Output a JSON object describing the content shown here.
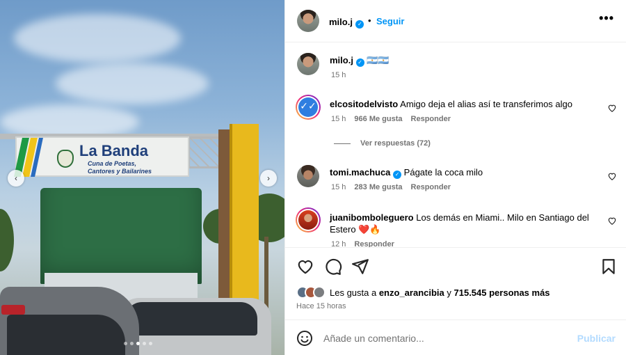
{
  "post": {
    "username": "milo.j",
    "follow_label": "Seguir",
    "separator": "•",
    "more_icon": "more-options-icon",
    "caption_emoji": "🇦🇷🇦🇷",
    "caption_time": "15 h"
  },
  "photo": {
    "sign_title": "La Banda",
    "sign_subtitle_1": "Cuna de Poetas,",
    "sign_subtitle_2": "Cantores y Bailarines",
    "prev_arrow": "‹",
    "next_arrow": "›",
    "slide_count": 5,
    "active_slide": 2
  },
  "comments": [
    {
      "username": "elcositodelvisto",
      "text": "Amigo deja el alias así te transferimos algo",
      "time": "15 h",
      "likes": "966 Me gusta",
      "reply": "Responder"
    },
    {
      "username": "tomi.machuca",
      "text": "Págate la coca milo",
      "time": "15 h",
      "likes": "283 Me gusta",
      "reply": "Responder"
    },
    {
      "username": "juanibomboleguero",
      "text": "Los demás en Miami.. Milo en Santiago del Estero ❤️🔥",
      "time": "12 h",
      "reply": "Responder"
    }
  ],
  "view_replies": "Ver respuestas (72)",
  "likes": {
    "prefix": "Les gusta a ",
    "user": "enzo_arancibia",
    "middle": " y ",
    "count": "715.545 personas más"
  },
  "time_ago": "Hace 15 horas",
  "composer": {
    "placeholder": "Añade un comentario...",
    "publish_label": "Publicar"
  },
  "colors": {
    "accent": "#0095f6",
    "muted": "#737373",
    "publish_disabled": "#b3dbff"
  }
}
